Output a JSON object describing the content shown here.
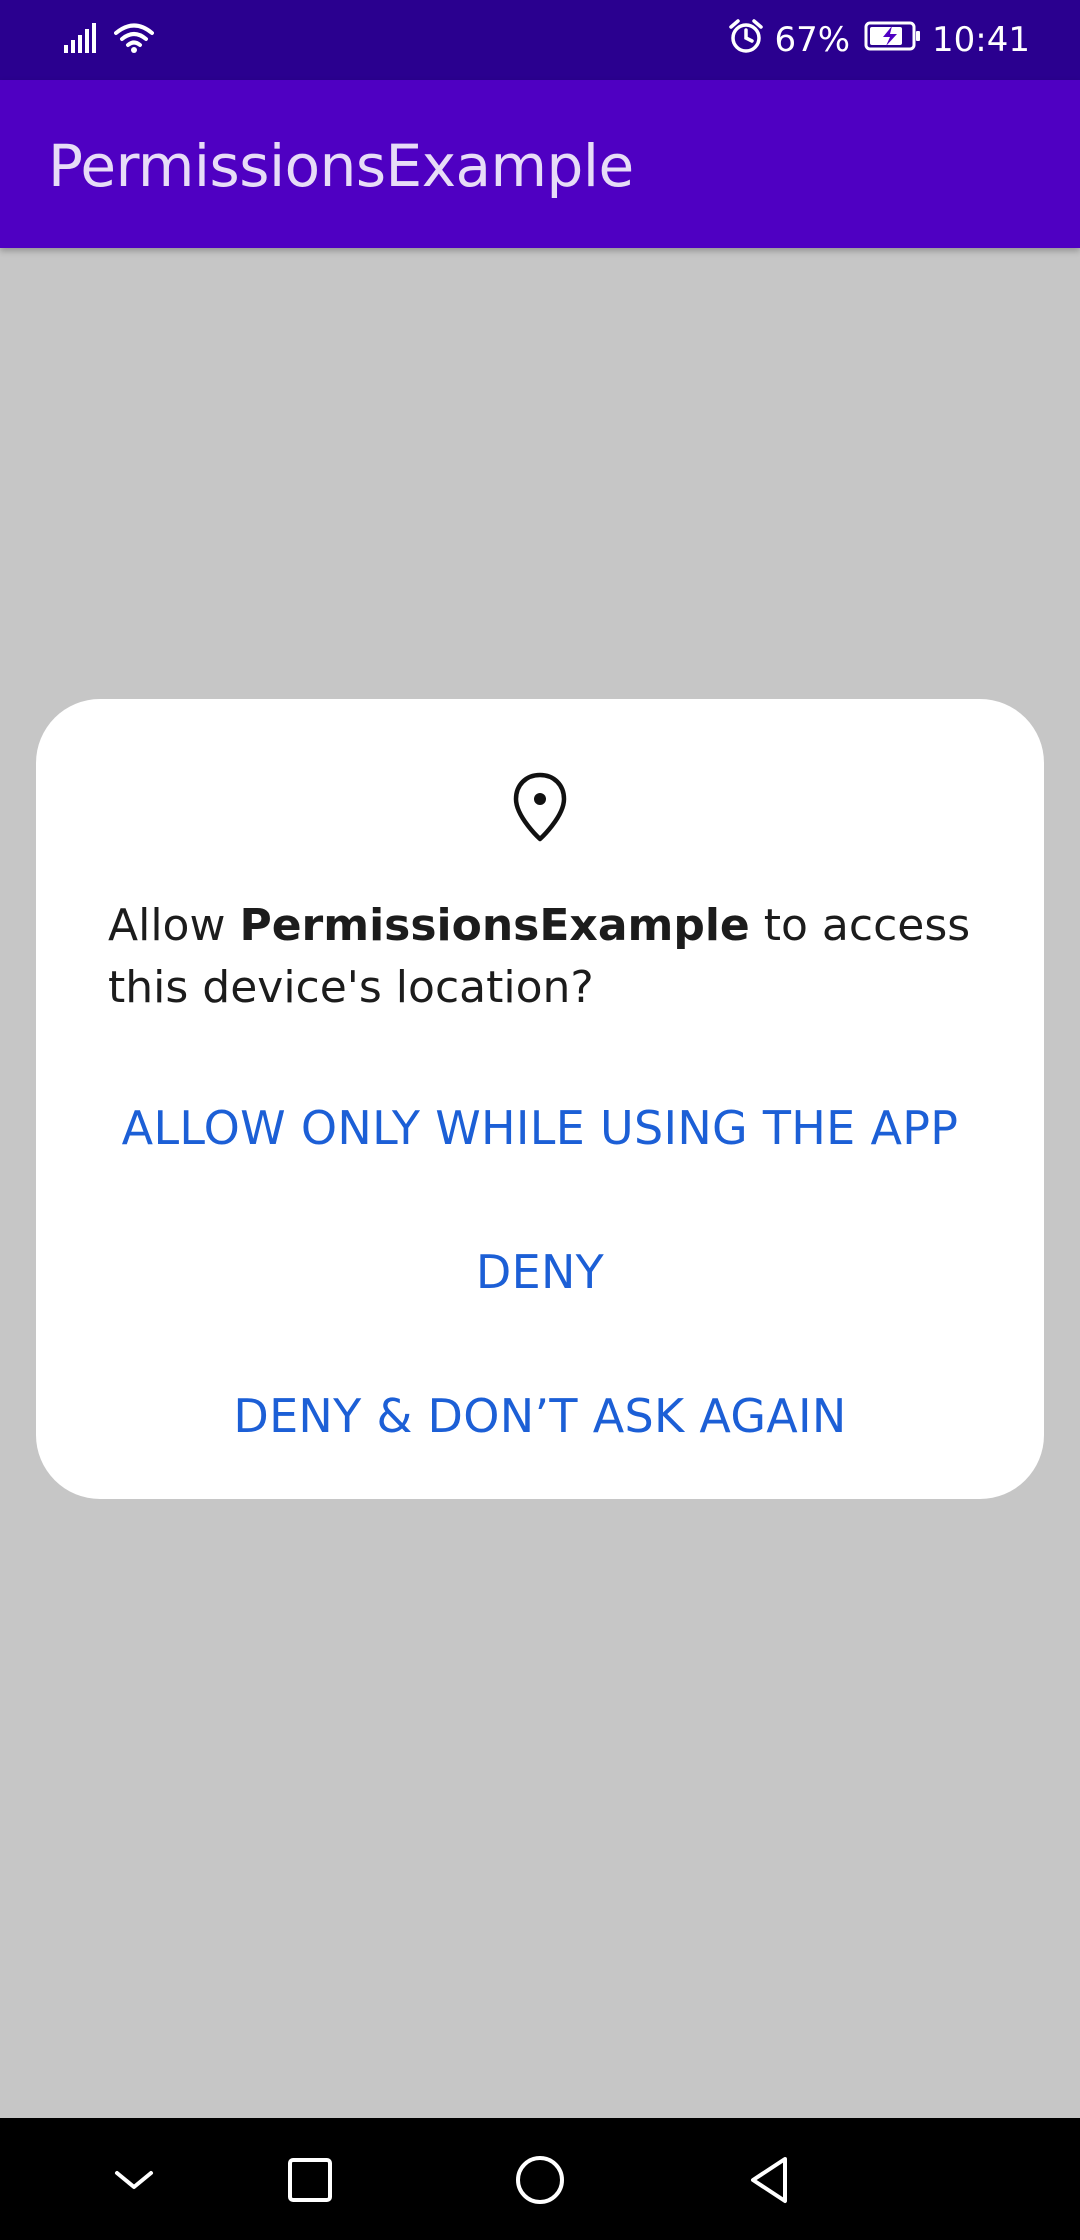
{
  "status_bar": {
    "battery_percent": "67%",
    "time": "10:41",
    "icons": [
      "signal-icon",
      "wifi-icon",
      "alarm-icon",
      "battery-charging-icon"
    ]
  },
  "app_bar": {
    "title": "PermissionsExample"
  },
  "dialog": {
    "icon": "location-pin-icon",
    "message_prefix": "Allow ",
    "message_app_name": "PermissionsExample",
    "message_suffix": " to access this device's location?",
    "buttons": {
      "allow_while_using": "ALLOW ONLY WHILE USING THE APP",
      "deny": "DENY",
      "deny_dont_ask": "DENY & DON’T ASK AGAIN"
    }
  },
  "nav_bar": {
    "icons": [
      "chevron-down-icon",
      "recents-icon",
      "home-icon",
      "back-icon"
    ]
  },
  "colors": {
    "status_bar_bg": "#2a008f",
    "app_bar_bg": "#4f00c2",
    "scrim_bg": "#c6c6c6",
    "dialog_bg": "#ffffff",
    "button_text": "#1c5fd6",
    "nav_bar_bg": "#000000"
  }
}
